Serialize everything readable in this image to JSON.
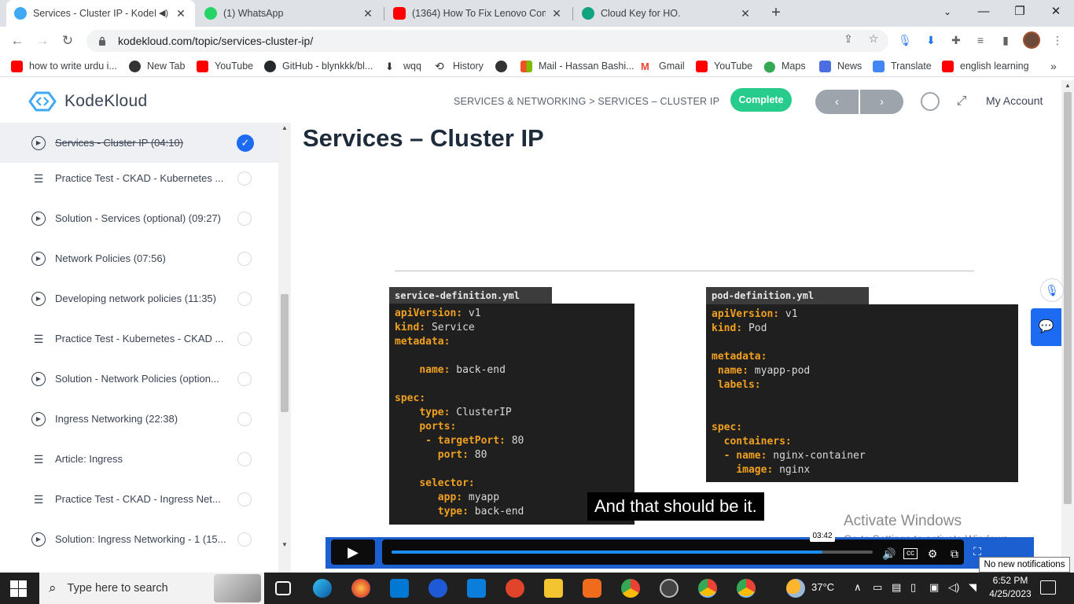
{
  "browser": {
    "tabs": [
      {
        "title": "Services - Cluster IP - KodeK",
        "active": true,
        "audio": true
      },
      {
        "title": "(1) WhatsApp",
        "active": false
      },
      {
        "title": "(1364) How To Fix Lenovo Compu",
        "active": false
      },
      {
        "title": "Cloud Key for HO.",
        "active": false
      }
    ],
    "url": "kodekloud.com/topic/services-cluster-ip/",
    "bookmarks": [
      "how to write urdu i...",
      "New Tab",
      "YouTube",
      "GitHub - blynkkk/bl...",
      "wqq",
      "History",
      "",
      "Mail - Hassan Bashi...",
      "Gmail",
      "YouTube",
      "Maps",
      "News",
      "Translate",
      "english learning"
    ]
  },
  "header": {
    "logo_text": "KodeKloud",
    "breadcrumb": "SERVICES & NETWORKING > SERVICES – CLUSTER IP",
    "complete_label": "Complete",
    "prev_glyph": "‹",
    "next_glyph": "›",
    "account_label": "My Account"
  },
  "sidebar": {
    "items": [
      {
        "label": "Services - Cluster IP (04:10)",
        "type": "video",
        "status": "done",
        "current": true
      },
      {
        "label": "Practice Test - CKAD - Kubernetes ...",
        "type": "lab",
        "status": "todo"
      },
      {
        "label": "Solution - Services (optional) (09:27)",
        "type": "video",
        "status": "todo"
      },
      {
        "label": "Network Policies (07:56)",
        "type": "video",
        "status": "todo"
      },
      {
        "label": "Developing network policies (11:35)",
        "type": "video",
        "status": "todo"
      },
      {
        "label": "Practice Test - Kubernetes - CKAD ...",
        "type": "lab",
        "status": "todo"
      },
      {
        "label": "Solution - Network Policies (option...",
        "type": "video",
        "status": "todo"
      },
      {
        "label": "Ingress Networking (22:38)",
        "type": "video",
        "status": "todo"
      },
      {
        "label": "Article: Ingress",
        "type": "lab",
        "status": "todo"
      },
      {
        "label": "Practice Test - CKAD - Ingress Net...",
        "type": "lab",
        "status": "todo"
      },
      {
        "label": "Solution: Ingress Networking - 1 (15...",
        "type": "video",
        "status": "todo"
      }
    ]
  },
  "main": {
    "title": "Services – Cluster IP",
    "service_file": {
      "name": "service-definition.yml",
      "lines": [
        [
          [
            "k",
            "apiVersion:"
          ],
          [
            "v",
            " v1"
          ]
        ],
        [
          [
            "k",
            "kind:"
          ],
          [
            "v",
            " Service"
          ]
        ],
        [
          [
            "k",
            "metadata:"
          ]
        ],
        [],
        [
          [
            "v",
            "    "
          ],
          [
            "k",
            "name:"
          ],
          [
            "v",
            " back-end"
          ]
        ],
        [],
        [
          [
            "k",
            "spec:"
          ]
        ],
        [
          [
            "v",
            "    "
          ],
          [
            "k",
            "type:"
          ],
          [
            "v",
            " ClusterIP"
          ]
        ],
        [
          [
            "v",
            "    "
          ],
          [
            "k",
            "ports:"
          ]
        ],
        [
          [
            "v",
            "     "
          ],
          [
            "k",
            "- targetPort:"
          ],
          [
            "v",
            " 80"
          ]
        ],
        [
          [
            "v",
            "       "
          ],
          [
            "k",
            "port:"
          ],
          [
            "v",
            " 80"
          ]
        ],
        [],
        [
          [
            "v",
            "    "
          ],
          [
            "k",
            "selector:"
          ]
        ],
        [
          [
            "v",
            "       "
          ],
          [
            "k",
            "app:"
          ],
          [
            "v",
            " myapp"
          ]
        ],
        [
          [
            "v",
            "       "
          ],
          [
            "k",
            "type:"
          ],
          [
            "v",
            " back-end"
          ]
        ]
      ]
    },
    "pod_file": {
      "name": "pod-definition.yml",
      "lines": [
        [
          [
            "k",
            "apiVersion:"
          ],
          [
            "v",
            " v1"
          ]
        ],
        [
          [
            "k",
            "kind:"
          ],
          [
            "v",
            " Pod"
          ]
        ],
        [],
        [
          [
            "k",
            "metadata:"
          ]
        ],
        [
          [
            "v",
            " "
          ],
          [
            "k",
            "name:"
          ],
          [
            "v",
            " myapp-pod"
          ]
        ],
        [
          [
            "v",
            " "
          ],
          [
            "k",
            "labels:"
          ]
        ],
        [],
        [],
        [
          [
            "k",
            "spec:"
          ]
        ],
        [
          [
            "v",
            "  "
          ],
          [
            "k",
            "containers:"
          ]
        ],
        [
          [
            "v",
            "  "
          ],
          [
            "k",
            "- name:"
          ],
          [
            "v",
            " nginx-container"
          ]
        ],
        [
          [
            "v",
            "    "
          ],
          [
            "k",
            "image:"
          ],
          [
            "v",
            " nginx"
          ]
        ]
      ]
    },
    "caption": "And that should be it.",
    "player": {
      "progress": 0.896,
      "hover_time": "03:42"
    },
    "watermark": {
      "line1": "Activate Windows",
      "line2": "Go to Settings to activate Windows."
    },
    "notification_toast": "No new notifications"
  },
  "taskbar": {
    "search_placeholder": "Type here to search",
    "weather": "37°C",
    "time": "6:52 PM",
    "date": "4/25/2023"
  },
  "colors": {
    "accent_green": "#27cc8c",
    "accent_blue": "#1d6bf3",
    "player_blue": "#1b5fd1",
    "code_key": "#f0a020"
  }
}
